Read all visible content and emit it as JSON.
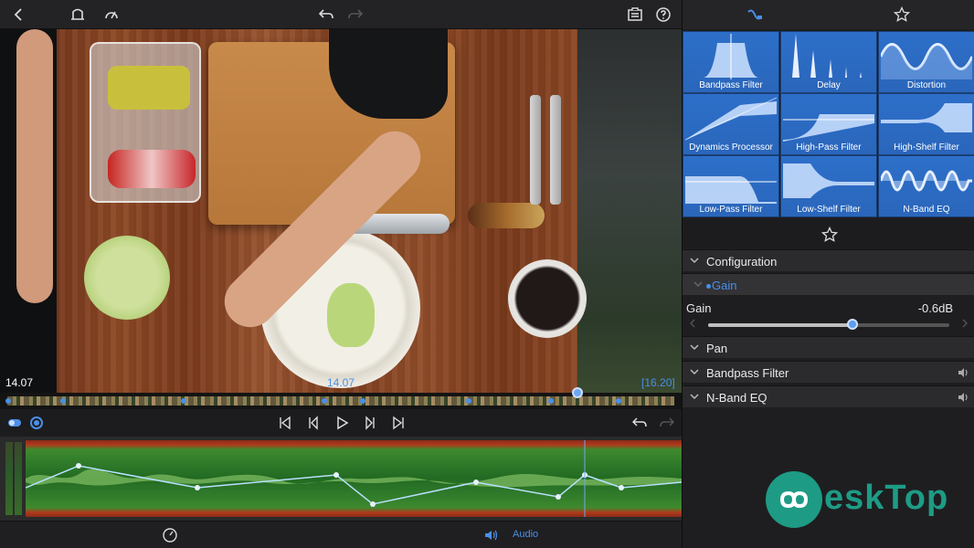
{
  "toolbar": {
    "icons": [
      "back-icon",
      "crop-icon",
      "speed-meter-icon",
      "undo-icon",
      "redo-icon",
      "clipboard-icon",
      "help-icon"
    ]
  },
  "video": {
    "time_current": "14.07",
    "time_marker": "14.07",
    "time_end": "[16.20]"
  },
  "timeline": {
    "playhead_fraction": 0.855
  },
  "bottom": {
    "audio_label": "Audio"
  },
  "panel": {
    "effects": [
      {
        "label": "Bandpass Filter"
      },
      {
        "label": "Delay"
      },
      {
        "label": "Distortion"
      },
      {
        "label": "Dynamics Processor"
      },
      {
        "label": "High-Pass Filter"
      },
      {
        "label": "High-Shelf Filter"
      },
      {
        "label": "Low-Pass Filter"
      },
      {
        "label": "Low-Shelf Filter"
      },
      {
        "label": "N-Band EQ"
      }
    ],
    "configuration": "Configuration",
    "gain_section": "Gain",
    "gain_label": "Gain",
    "gain_value": "-0.6dB",
    "gain_fraction": 0.6,
    "pan": "Pan",
    "bandpass": "Bandpass Filter",
    "nband": "N-Band EQ",
    "accent_color": "#4a8fe6"
  },
  "watermark": {
    "text": "eskTop"
  }
}
